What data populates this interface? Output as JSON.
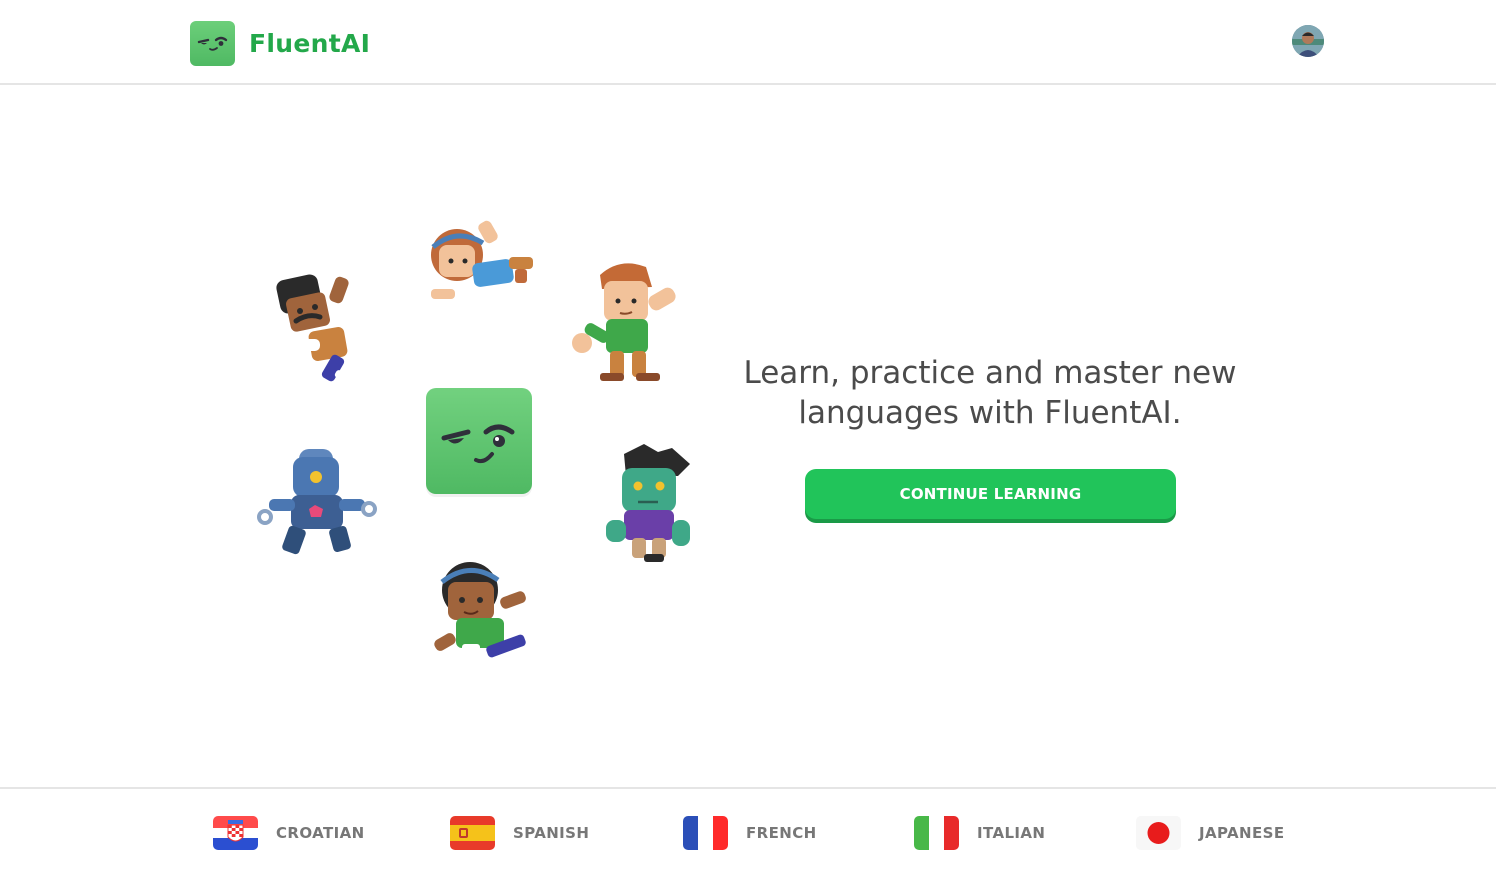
{
  "header": {
    "brand_name": "FluentAI",
    "logo_icon": "fluentai-mascot-logo",
    "avatar_icon": "user-avatar"
  },
  "hero": {
    "headline": "Learn, practice and master new languages with FluentAI.",
    "cta_label": "CONTINUE LEARNING",
    "characters": [
      "character-man-mustache",
      "character-girl-headband",
      "character-boy-brown-hair",
      "character-robot",
      "character-zombie",
      "character-girl-green-shirt"
    ],
    "center_logo_icon": "fluentai-mascot-face"
  },
  "footer": {
    "languages": [
      {
        "label": "CROATIAN",
        "flag": "croatia-flag"
      },
      {
        "label": "SPANISH",
        "flag": "spain-flag"
      },
      {
        "label": "FRENCH",
        "flag": "france-flag"
      },
      {
        "label": "ITALIAN",
        "flag": "italy-flag"
      },
      {
        "label": "JAPANESE",
        "flag": "japan-flag"
      }
    ]
  },
  "colors": {
    "brand_green": "#23a84a",
    "cta_green": "#21c45a",
    "cta_shadow": "#1a9a47",
    "text_dark": "#4b4b4b",
    "text_muted": "#777777",
    "divider": "#e5e5e5"
  }
}
